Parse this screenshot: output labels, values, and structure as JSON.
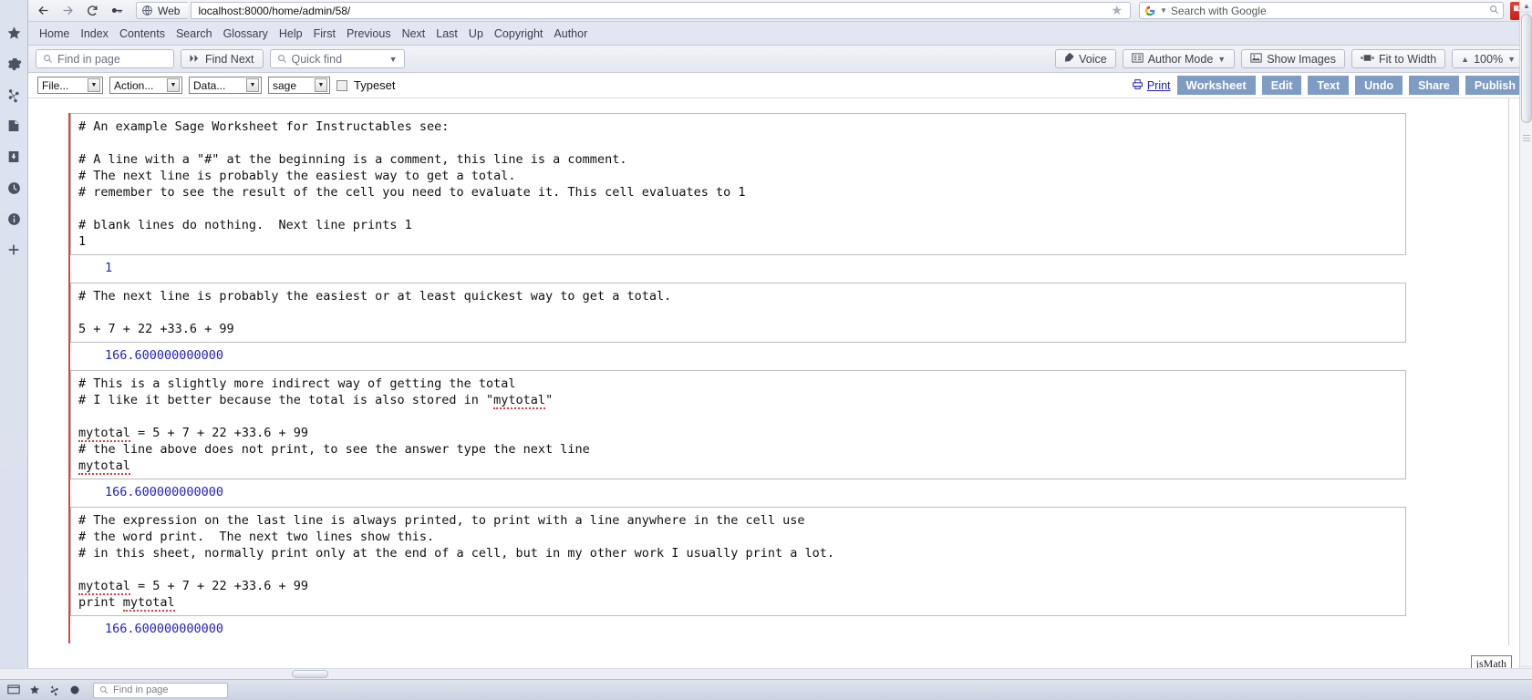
{
  "browser": {
    "nav": {
      "back_icon": "arrow-left-icon",
      "forward_icon": "arrow-right-icon",
      "reload_icon": "reload-icon",
      "key_icon": "key-icon",
      "web_chip_label": "Web",
      "url": "localhost:8000/home/admin/58/",
      "bookmark_icon": "star-icon"
    },
    "search": {
      "placeholder": "Search with Google",
      "engine_icon": "google-icon",
      "magnifier_icon": "search-icon"
    }
  },
  "sidebar": {
    "items": [
      {
        "name": "favorites",
        "icon": "star-icon"
      },
      {
        "name": "settings",
        "icon": "gear-icon"
      },
      {
        "name": "share",
        "icon": "share-icon"
      },
      {
        "name": "notes",
        "icon": "note-icon"
      },
      {
        "name": "downloads",
        "icon": "download-icon"
      },
      {
        "name": "history",
        "icon": "clock-icon"
      },
      {
        "name": "info",
        "icon": "info-icon"
      },
      {
        "name": "add",
        "icon": "plus-icon"
      }
    ]
  },
  "linkbar": {
    "links": [
      "Home",
      "Index",
      "Contents",
      "Search",
      "Glossary",
      "Help",
      "First",
      "Previous",
      "Next",
      "Last",
      "Up",
      "Copyright",
      "Author"
    ]
  },
  "findbar": {
    "find_in_page_placeholder": "Find in page",
    "find_next_label": "Find Next",
    "quick_find_placeholder": "Quick find",
    "voice_label": "Voice",
    "author_mode_label": "Author Mode",
    "show_images_label": "Show Images",
    "fit_to_width_label": "Fit to Width",
    "zoom_level": "100%"
  },
  "sage_toolbar": {
    "file_label": "File...",
    "action_label": "Action...",
    "data_label": "Data...",
    "system_label": "sage",
    "typeset_label": "Typeset",
    "print_label": "Print",
    "buttons": [
      "Worksheet",
      "Edit",
      "Text",
      "Undo",
      "Share",
      "Publish"
    ]
  },
  "worksheet": {
    "cells": [
      {
        "input": "# An example Sage Worksheet for Instructables see:\n\n# A line with a \"#\" at the beginning is a comment, this line is a comment.\n# The next line is probably the easiest way to get a total.\n# remember to see the result of the cell you need to evaluate it. This cell evaluates to 1\n\n# blank lines do nothing.  Next line prints 1\n1",
        "output": "1"
      },
      {
        "input": "# The next line is probably the easiest or at least quickest way to get a total.\n\n5 + 7 + 22 +33.6 + 99",
        "output": "166.600000000000"
      },
      {
        "input": "# This is a slightly more indirect way of getting the total\n# I like it better because the total is also stored in \"mytotal\"\n\nmytotal = 5 + 7 + 22 +33.6 + 99\n# the line above does not print, to see the answer type the next line\nmytotal",
        "output": "166.600000000000"
      },
      {
        "input": "# The expression on the last line is always printed, to print with a line anywhere in the cell use\n# the word print.  The next two lines show this.\n# in this sheet, normally print only at the end of a cell, but in my other work I usually print a lot.\n\nmytotal = 5 + 7 + 22 +33.6 + 99\nprint mytotal",
        "output": "166.600000000000"
      }
    ],
    "jsmath_label": "jsMath"
  },
  "taskbar": {
    "find_placeholder": "Find in page"
  },
  "colors": {
    "accent_blue": "#7e9cc4",
    "output_blue": "#2222cc",
    "cell_marker_red": "#d24a4a",
    "chrome_bg": "#e2e6f2"
  }
}
